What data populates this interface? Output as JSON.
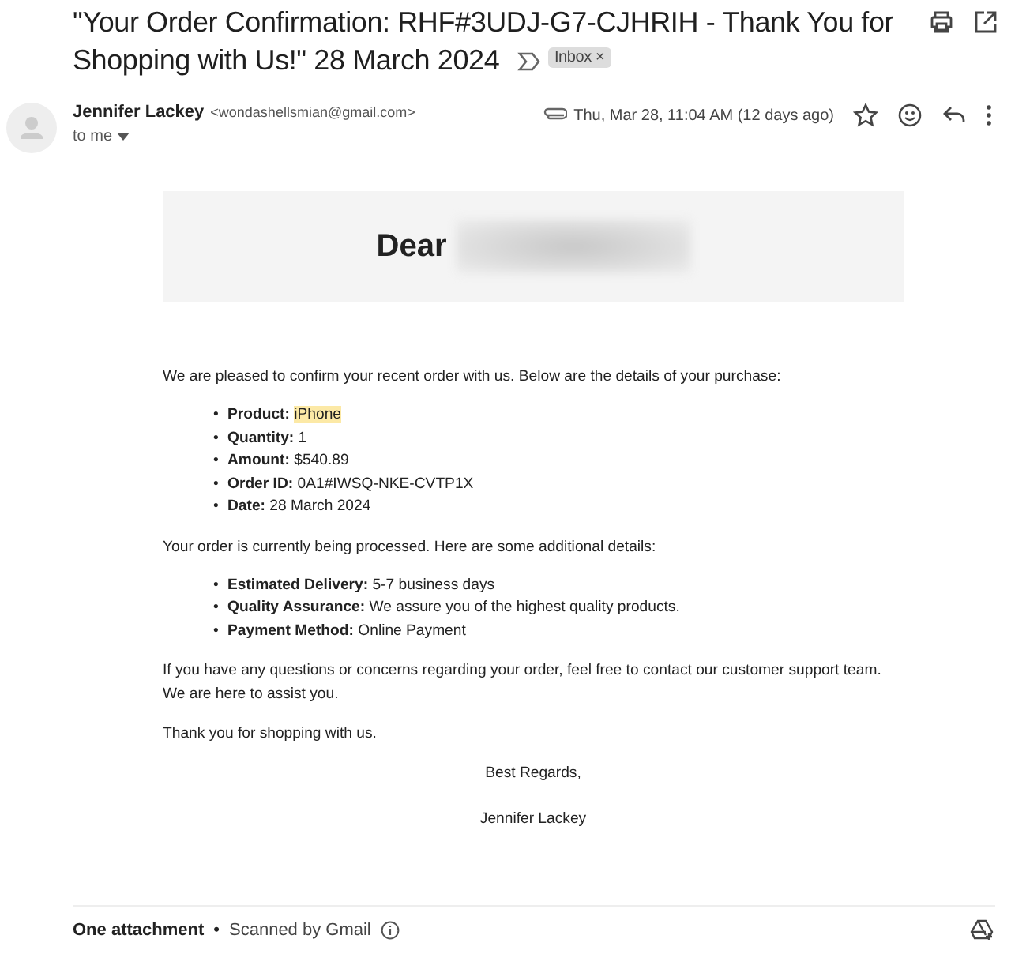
{
  "subject": {
    "title": "\"Your Order Confirmation: RHF#3UDJ-G7-CJHRIH - Thank You for Shopping with Us!\" 28 March 2024",
    "label": "Inbox ×"
  },
  "sender": {
    "name": "Jennifer Lackey",
    "email": "<wondashellsmian@gmail.com>",
    "recipient": "to me",
    "date": "Thu, Mar 28, 11:04 AM (12 days ago)"
  },
  "body": {
    "greeting": "Dear",
    "bullet": "•",
    "intro": "We are pleased to confirm your recent order with us. Below are the details of your purchase:",
    "order_details": [
      {
        "label": "Product:",
        "value": "iPhone",
        "highlighted": true
      },
      {
        "label": "Quantity:",
        "value": "1",
        "highlighted": false
      },
      {
        "label": "Amount:",
        "value": "$540.89",
        "highlighted": false
      },
      {
        "label": "Order ID:",
        "value": "0A1#IWSQ-NKE-CVTP1X",
        "highlighted": false
      },
      {
        "label": "Date:",
        "value": "28 March 2024",
        "highlighted": false
      }
    ],
    "processing": "Your order is currently being processed. Here are some additional details:",
    "additional_details": [
      {
        "label": "Estimated Delivery:",
        "value": "5-7 business days",
        "highlighted": false
      },
      {
        "label": "Quality Assurance:",
        "value": "We assure you of the highest quality products.",
        "highlighted": false
      },
      {
        "label": "Payment Method:",
        "value": "Online Payment",
        "highlighted": false
      }
    ],
    "support": "If you have any questions or concerns regarding your order, feel free to contact our customer support team. We are here to assist you.",
    "thanks": "Thank you for shopping with us.",
    "closing": "Best Regards,",
    "signature": "Jennifer Lackey"
  },
  "footer": {
    "attachments": "One attachment",
    "separator": "•",
    "scan": "Scanned by Gmail"
  }
}
